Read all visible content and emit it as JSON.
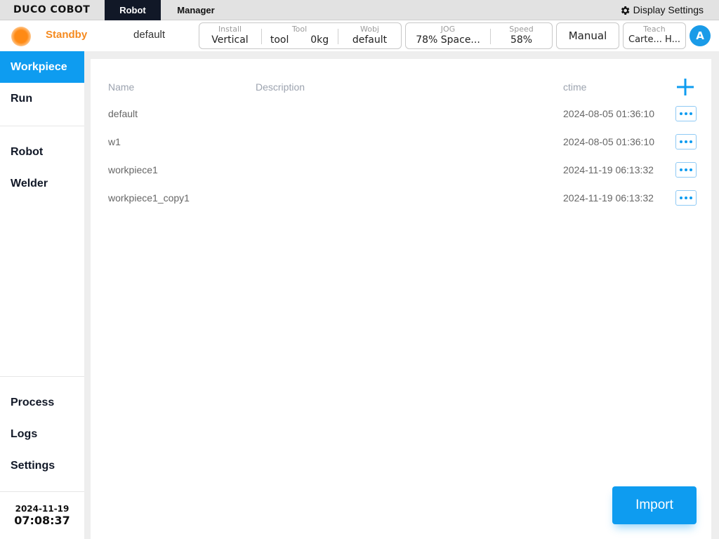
{
  "app": {
    "logo": "DUCO COBOT",
    "tabs": [
      "Robot",
      "Manager"
    ],
    "display_settings": "Display Settings"
  },
  "status": {
    "state": "Standby",
    "program": "default",
    "install": {
      "label": "Install",
      "value": "Vertical"
    },
    "tool": {
      "label": "Tool",
      "name": "tool",
      "weight": "0kg"
    },
    "wobj": {
      "label": "Wobj",
      "value": "default"
    },
    "jog": {
      "label": "JOG",
      "value": "78%  Space..."
    },
    "speed": {
      "label": "Speed",
      "value": "58%"
    },
    "mode": "Manual",
    "teach": {
      "label": "Teach",
      "value": "Carte... H..."
    },
    "avatar": "A",
    "colors": {
      "standby": "#f58a1f",
      "accent": "#0e9cf0"
    }
  },
  "sidebar": {
    "items": [
      {
        "label": "Workpiece",
        "active": true
      },
      {
        "label": "Run",
        "active": false
      },
      {
        "label": "Robot",
        "active": false
      },
      {
        "label": "Welder",
        "active": false
      },
      {
        "label": "Process",
        "active": false
      },
      {
        "label": "Logs",
        "active": false
      },
      {
        "label": "Settings",
        "active": false
      }
    ],
    "date": "2024-11-19",
    "time": "07:08:37"
  },
  "table": {
    "headers": {
      "name": "Name",
      "description": "Description",
      "ctime": "ctime"
    },
    "rows": [
      {
        "name": "default",
        "description": "",
        "ctime": "2024-08-05 01:36:10"
      },
      {
        "name": "w1",
        "description": "",
        "ctime": "2024-08-05 01:36:10"
      },
      {
        "name": "workpiece1",
        "description": "",
        "ctime": "2024-11-19 06:13:32"
      },
      {
        "name": "workpiece1_copy1",
        "description": "",
        "ctime": "2024-11-19 06:13:32"
      }
    ]
  },
  "actions": {
    "add_icon": "plus-icon",
    "more_icon": "more-horizontal-icon",
    "import": "Import"
  }
}
